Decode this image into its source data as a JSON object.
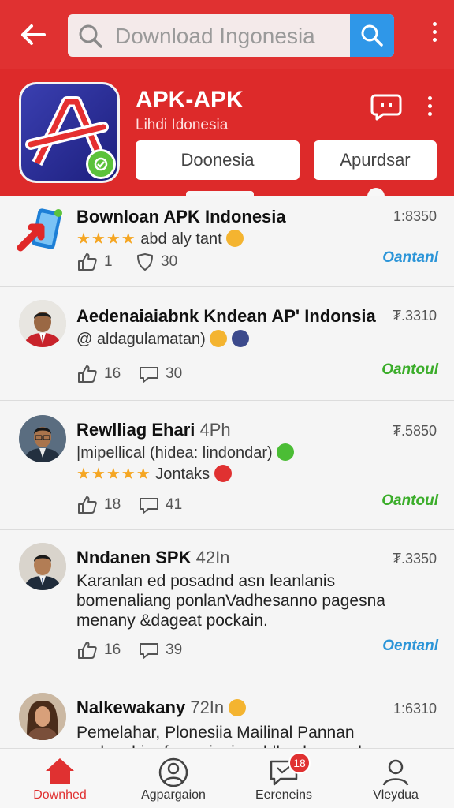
{
  "search": {
    "placeholder": "Download Ingonesia"
  },
  "app": {
    "name": "APK-APK",
    "subtitle": "Lihdi Idonesia",
    "buttons": [
      "Doonesia",
      "Apurdsar"
    ]
  },
  "posts": [
    {
      "title": "Bownloan APK  Indonesia",
      "time": "1:8350",
      "stars": "★★★★",
      "line": "abd aly tant",
      "likes": "1",
      "comments": "30",
      "action": "Oantanl",
      "action_color": "#2c95d8"
    },
    {
      "title": "Aedenaiaiabnk Kndean AP' Indonsia",
      "time": "₮.3310",
      "line": "@ aldagulamatan)",
      "likes": "16",
      "comments": "30",
      "action": "Oantoul",
      "action_color": "#3bad2a"
    },
    {
      "title": "Rewlliag Ehari",
      "title_suffix": "4Ph",
      "time": "₮.5850",
      "line": "|mipellical (hidea: lindondar)",
      "stars": "★★★★★",
      "line2": "Jontaks",
      "likes": "18",
      "comments": "41",
      "action": "Oantoul",
      "action_color": "#3bad2a"
    },
    {
      "title": "Nndanen SPK",
      "title_suffix": "42In",
      "time": "₮.3350",
      "body": "Karanlan ed posadnd asn leanlanis bomenaliang ponlanVadhesanno pagesna menany &dageat pockain.",
      "likes": "16",
      "comments": "39",
      "action": "Oentanl",
      "action_color": "#2c95d8"
    },
    {
      "title": "Nalkewakany",
      "title_suffix": "72In",
      "time": "1:6310",
      "body": "Pemelahar, Plonesiia Mailinal Pannan andonghiar fcamainain nddlan kanan da sranaladandnanid"
    }
  ],
  "nav": {
    "items": [
      "Downhed",
      "Agpargaion",
      "Eereneins",
      "Vleydua"
    ],
    "badge": "18",
    "active_color": "#e03131"
  },
  "colors": {
    "primary": "#e03131",
    "header": "#dd2a2a",
    "search_button": "#2f97e8"
  }
}
